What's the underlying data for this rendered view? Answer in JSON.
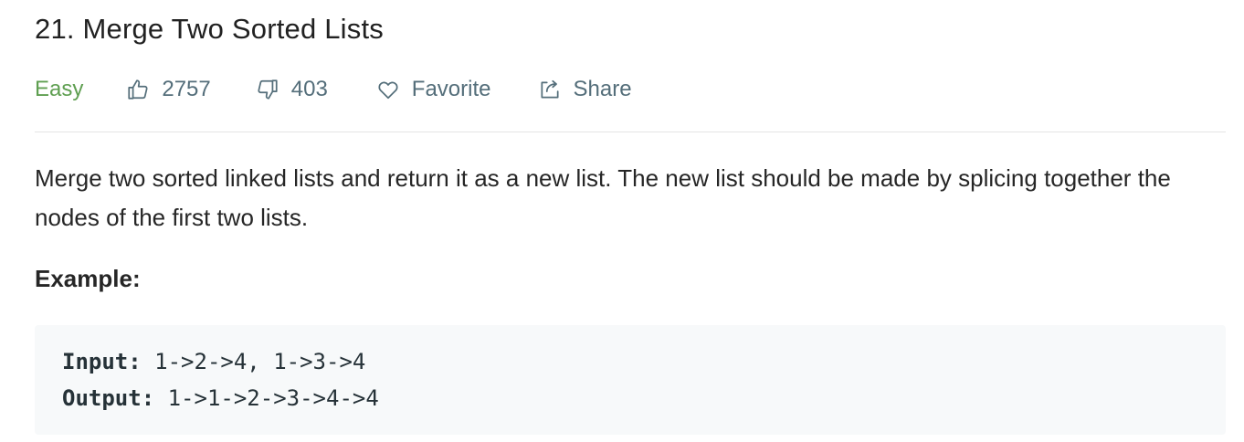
{
  "problem": {
    "title": "21. Merge Two Sorted Lists",
    "difficulty": "Easy",
    "likes": "2757",
    "dislikes": "403",
    "favorite_label": "Favorite",
    "share_label": "Share",
    "description": "Merge two sorted linked lists and return it as a new list. The new list should be made by splicing together the nodes of the first two lists.",
    "example_heading": "Example:",
    "example": {
      "input_label": "Input:",
      "input_value": " 1->2->4, 1->3->4",
      "output_label": "Output:",
      "output_value": " 1->1->2->3->4->4"
    }
  },
  "icons": {
    "like": "thumbs-up-icon",
    "dislike": "thumbs-down-icon",
    "favorite": "heart-icon",
    "share": "share-icon"
  },
  "colors": {
    "difficulty_easy": "#5f9f51",
    "meta_text": "#546e7a",
    "code_background": "#f7f9fa"
  }
}
